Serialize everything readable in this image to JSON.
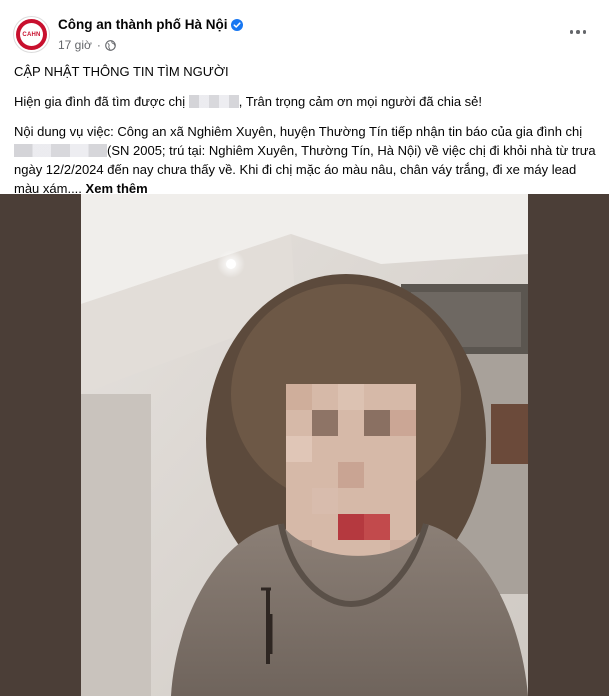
{
  "header": {
    "page_name": "Công an thành phố Hà Nội",
    "time": "17 giờ",
    "separator": "·",
    "avatar_logo_text": "CAHN",
    "more_icon": "ellipsis-horizontal-icon",
    "verified_icon": "verified-badge-icon",
    "privacy_icon": "globe-icon"
  },
  "post": {
    "heading": "CẬP NHẬT THÔNG TIN TÌM NGƯỜI",
    "update_before": "Hiện gia đình đã tìm được chị ",
    "update_after": ", Trân trọng cảm ơn mọi người đã chia sẻ!",
    "details_1": "Nội dung vụ việc: Công an xã Nghiêm Xuyên, huyện Thường Tín tiếp nhận tin báo của gia đình chị ",
    "details_2": "(SN 2005; trú tại: Nghiêm Xuyên, Thường Tín, Hà Nội) về việc chị đi khỏi nhà từ trưa ngày 12/2/2024 đến nay chưa thấy về. Khi đi chị mặc áo màu nâu, chân váy trắng, đi xe máy lead màu xám....",
    "see_more": "Xem thêm"
  },
  "colors": {
    "brand_red": "#c8102e",
    "verified_blue": "#1877f2",
    "meta_gray": "#65676b",
    "photo_border": "#4b3e37"
  }
}
